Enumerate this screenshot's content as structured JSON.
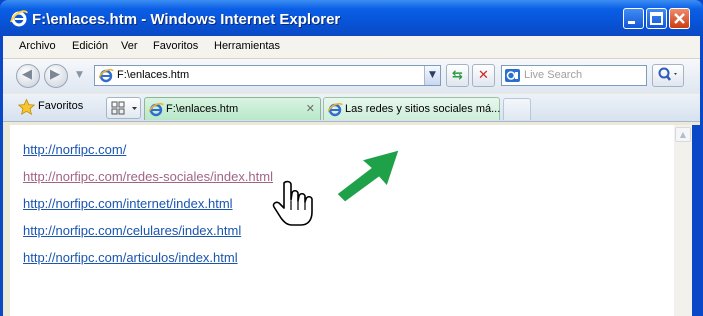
{
  "window": {
    "title": "F:\\enlaces.htm - Windows Internet Explorer",
    "icon": "ie-icon"
  },
  "menubar": {
    "items": [
      "Archivo",
      "Edición",
      "Ver",
      "Favoritos",
      "Herramientas"
    ]
  },
  "navigation": {
    "address": "F:\\enlaces.htm",
    "search_placeholder": "Live Search"
  },
  "tabbar": {
    "favorites_label": "Favoritos",
    "tabs": [
      {
        "label": "F:\\enlaces.htm",
        "active": true
      },
      {
        "label": "Las redes y sitios sociales má...",
        "active": false
      }
    ]
  },
  "content": {
    "links": [
      {
        "text": "http://norfipc.com/",
        "visited": false
      },
      {
        "text": "http://norfipc.com/redes-sociales/index.html",
        "visited": true
      },
      {
        "text": "http://norfipc.com/internet/index.html",
        "visited": false
      },
      {
        "text": "http://norfipc.com/celulares/index.html",
        "visited": false
      },
      {
        "text": "http://norfipc.com/articulos/index.html",
        "visited": false
      }
    ]
  },
  "colors": {
    "titlebar": "#0a5fe6",
    "link": "#1a55b0",
    "visited_link": "#a26485",
    "annotation_arrow": "#1fa14a"
  }
}
